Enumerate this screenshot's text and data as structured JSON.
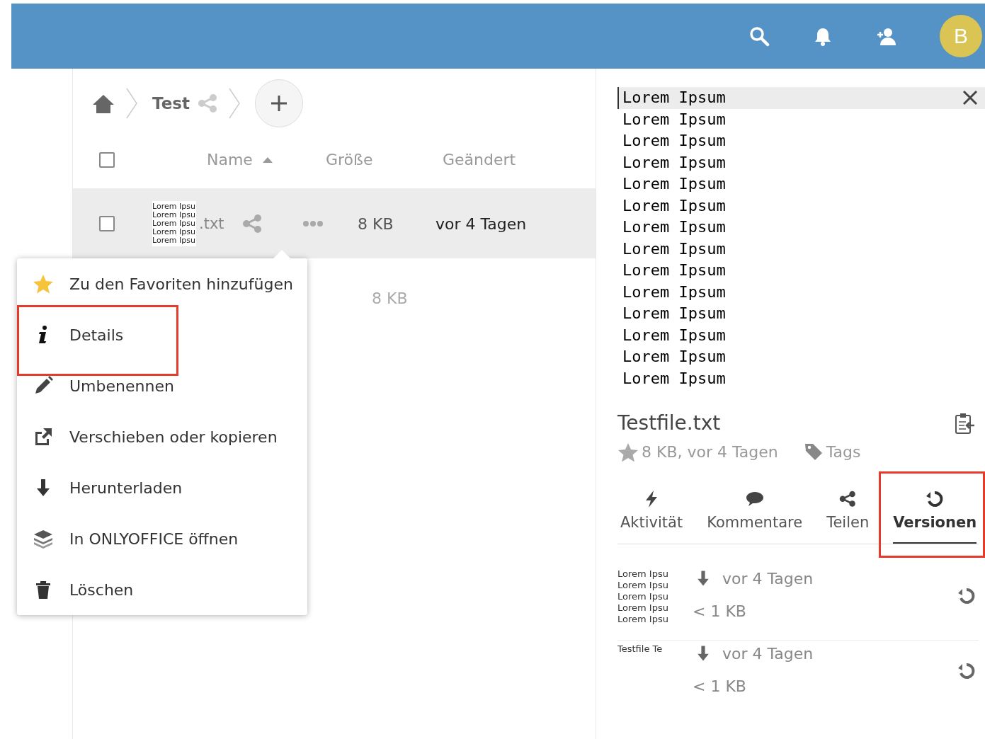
{
  "header": {
    "avatar_letter": "B"
  },
  "breadcrumb": {
    "folder": "Test"
  },
  "table": {
    "checked": false,
    "columns": [
      {
        "label": "Name",
        "sorted": true
      },
      {
        "label": "Größe",
        "sorted": false
      },
      {
        "label": "Geändert",
        "sorted": false
      }
    ],
    "rows": [
      {
        "selected": true,
        "checked": false,
        "thumbnail": [
          "Lorem Ipsu",
          "Lorem Ipsu",
          "Lorem Ipsu",
          "Lorem Ipsu",
          "Lorem Ipsu"
        ],
        "name": ".txt",
        "size": "8 KB",
        "modified": "vor 4 Tagen"
      },
      {
        "selected": false,
        "size": "8 KB"
      }
    ]
  },
  "menu": [
    {
      "kind": "star",
      "label": "Zu den Favoriten hinzufügen",
      "highlighted": false
    },
    {
      "kind": "info",
      "label": "Details",
      "highlighted": true
    },
    {
      "kind": "pencil",
      "label": "Umbenennen",
      "highlighted": false
    },
    {
      "kind": "external",
      "label": "Verschieben oder kopieren",
      "highlighted": false
    },
    {
      "kind": "download",
      "label": "Herunterladen",
      "highlighted": false
    },
    {
      "kind": "layers",
      "label": "In ONLYOFFICE öffnen",
      "highlighted": false
    },
    {
      "kind": "trash",
      "label": "Löschen",
      "highlighted": false
    }
  ],
  "preview": {
    "lines": [
      "Lorem Ipsum",
      "Lorem Ipsum",
      "Lorem Ipsum",
      "Lorem Ipsum",
      "Lorem Ipsum",
      "Lorem Ipsum",
      "Lorem Ipsum",
      "Lorem Ipsum",
      "Lorem Ipsum",
      "Lorem Ipsum",
      "Lorem Ipsum",
      "Lorem Ipsum",
      "Lorem Ipsum",
      "Lorem Ipsum"
    ]
  },
  "sidebar": {
    "title": "Testfile.txt",
    "meta": "8 KB, vor 4 Tagen",
    "tags": "Tags",
    "tabs": [
      {
        "kind": "activity",
        "label": "Aktivität",
        "selected": false,
        "highlighted": false
      },
      {
        "kind": "comments",
        "label": "Kommentare",
        "selected": false,
        "highlighted": false
      },
      {
        "kind": "share",
        "label": "Teilen",
        "selected": false,
        "highlighted": false
      },
      {
        "kind": "versions",
        "label": "Versionen",
        "selected": true,
        "highlighted": true
      }
    ],
    "versions": [
      {
        "thumbnail": [
          "Lorem Ipsu",
          "Lorem Ipsu",
          "Lorem Ipsu",
          "Lorem Ipsu",
          "Lorem Ipsu"
        ],
        "time": "vor 4 Tagen",
        "size": "< 1 KB"
      },
      {
        "thumbnail": [
          "Testfile Te"
        ],
        "time": "vor 4 Tagen",
        "size": "< 1 KB"
      }
    ]
  }
}
